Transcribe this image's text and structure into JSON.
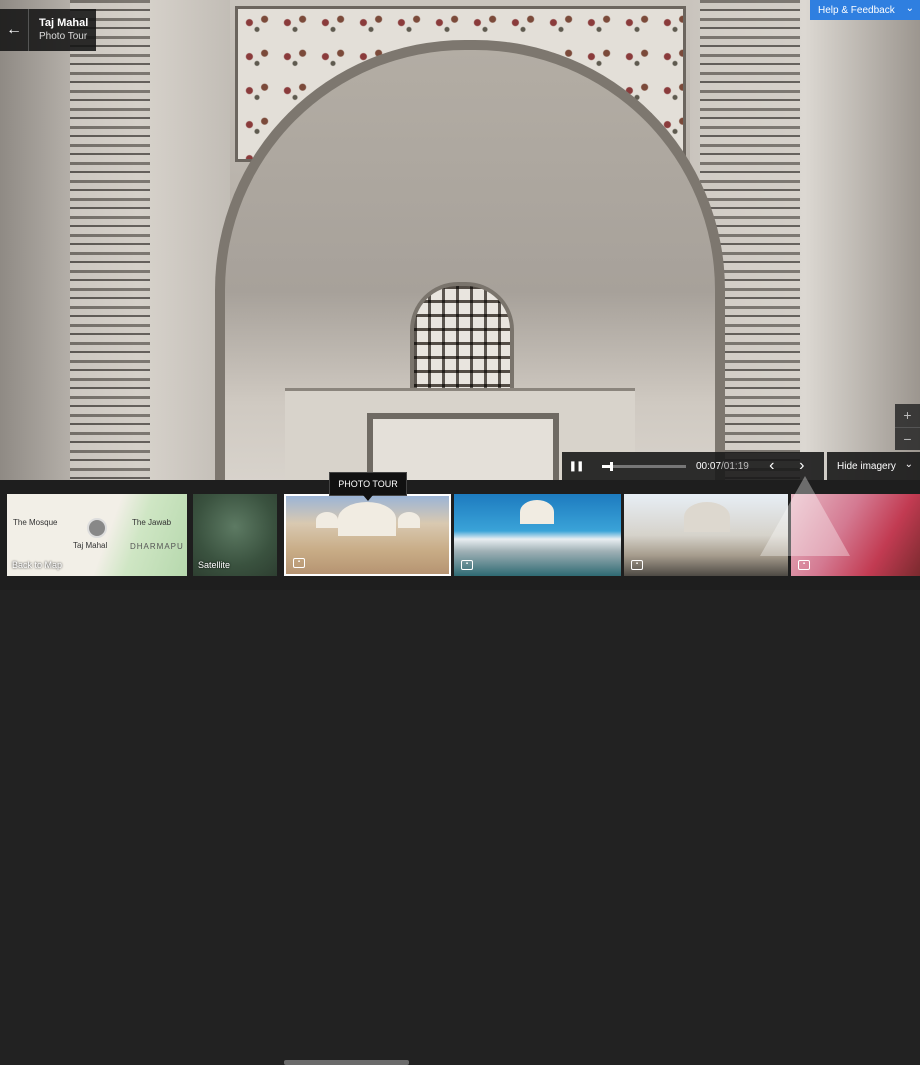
{
  "tour": {
    "title": "Taj Mahal",
    "subtitle": "Photo Tour",
    "back_icon": "←"
  },
  "help": {
    "label": "Help & Feedback",
    "chevron": "⌄"
  },
  "zoom": {
    "in": "+",
    "out": "−"
  },
  "player": {
    "pause_icon": "❚❚",
    "current": "00:07",
    "total": "/01:19",
    "progress": 0.09,
    "prev_icon": "‹",
    "next_icon": "›"
  },
  "imagery": {
    "label": "Hide imagery",
    "chevron": "⌄"
  },
  "tooltip": {
    "label": "PHOTO TOUR"
  },
  "thumbs": {
    "map": {
      "label": "Back to Map",
      "the_mosque": "The Mosque",
      "the_jawab": "The Jawab",
      "taj_mahal": "Taj Mahal",
      "dharmapur": "DHARMAPU"
    },
    "satellite": {
      "label": "Satellite"
    }
  },
  "colors": {
    "accent": "#2f7fe0"
  }
}
